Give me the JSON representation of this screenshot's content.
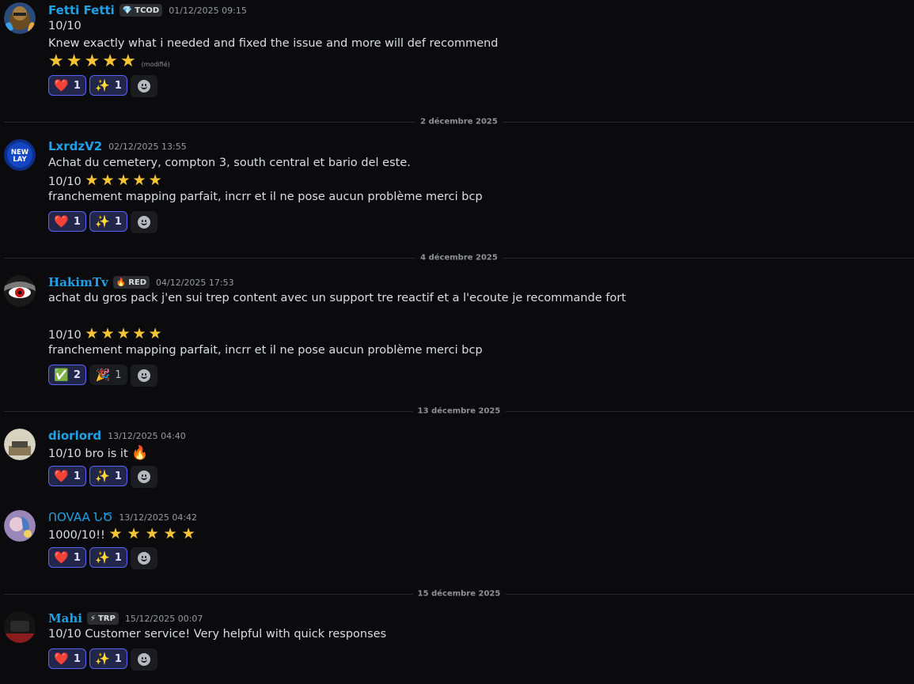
{
  "messages": [
    {
      "username": "Fetti Fetti",
      "tag": {
        "icon": "💎",
        "text": "TCOD"
      },
      "timestamp": "01/12/2025 09:15",
      "lines": [
        "10/10",
        "Knew exactly what i needed and fixed the issue and more will def recommend"
      ],
      "stars": 5,
      "edited": "(modifié)",
      "reactions": [
        {
          "emoji": "❤️",
          "count": "1",
          "active": true
        },
        {
          "emoji": "✨",
          "count": "1",
          "active": true
        }
      ]
    },
    {
      "username": "LxrdzV2",
      "timestamp": "02/12/2025 13:55",
      "lines": [
        "Achat du cemetery, compton 3, south central et bario del este.",
        "10/10",
        "franchement mapping parfait, incrr et il ne pose aucun problème merci bcp"
      ],
      "stars": 5,
      "reactions": [
        {
          "emoji": "❤️",
          "count": "1",
          "active": true
        },
        {
          "emoji": "✨",
          "count": "1",
          "active": true
        }
      ]
    },
    {
      "username": "HakimTv",
      "tag": {
        "icon": "🔥",
        "text": "RED"
      },
      "timestamp": "04/12/2025 17:53",
      "lines": [
        "achat du gros pack j'en sui trep content avec un support tre reactif et a l'ecoute je recommande fort",
        "10/10",
        "franchement mapping parfait, incrr et il ne pose aucun problème merci bcp"
      ],
      "stars": 5,
      "reactions": [
        {
          "emoji": "✅",
          "count": "2",
          "active": true
        },
        {
          "emoji": "🎉",
          "count": "1",
          "active": false
        }
      ]
    },
    {
      "username": "diorlord",
      "timestamp": "13/12/2025 04:40",
      "lines": [
        "10/10 bro is it"
      ],
      "emoji": "🔥",
      "reactions": [
        {
          "emoji": "❤️",
          "count": "1",
          "active": true
        },
        {
          "emoji": "✨",
          "count": "1",
          "active": true
        }
      ]
    },
    {
      "username": "ՈOVAA ՆԾ",
      "timestamp": "13/12/2025 04:42",
      "lines": [
        "1000/10!!"
      ],
      "stars": 5,
      "reactions": [
        {
          "emoji": "❤️",
          "count": "1",
          "active": true
        },
        {
          "emoji": "✨",
          "count": "1",
          "active": true
        }
      ]
    },
    {
      "username": "Mahi",
      "tag": {
        "icon": "⚡",
        "text": "TRP"
      },
      "timestamp": "15/12/2025 00:07",
      "lines": [
        "10/10 Customer service! Very helpful with quick responses"
      ],
      "reactions": [
        {
          "emoji": "❤️",
          "count": "1",
          "active": true
        },
        {
          "emoji": "✨",
          "count": "1",
          "active": true
        }
      ]
    }
  ],
  "dividers": [
    "2 décembre 2025",
    "4 décembre 2025",
    "13 décembre 2025",
    "15 décembre 2025"
  ],
  "colors": {
    "background": "#0b0b0e",
    "username": "#1fa1e8",
    "text": "#dbdee1",
    "timestamp": "#949ba4",
    "reaction_border": "#5865f2",
    "star": "#f7c531"
  },
  "icons": {
    "add_reaction": "smiley-face-icon",
    "star": "star-icon"
  }
}
